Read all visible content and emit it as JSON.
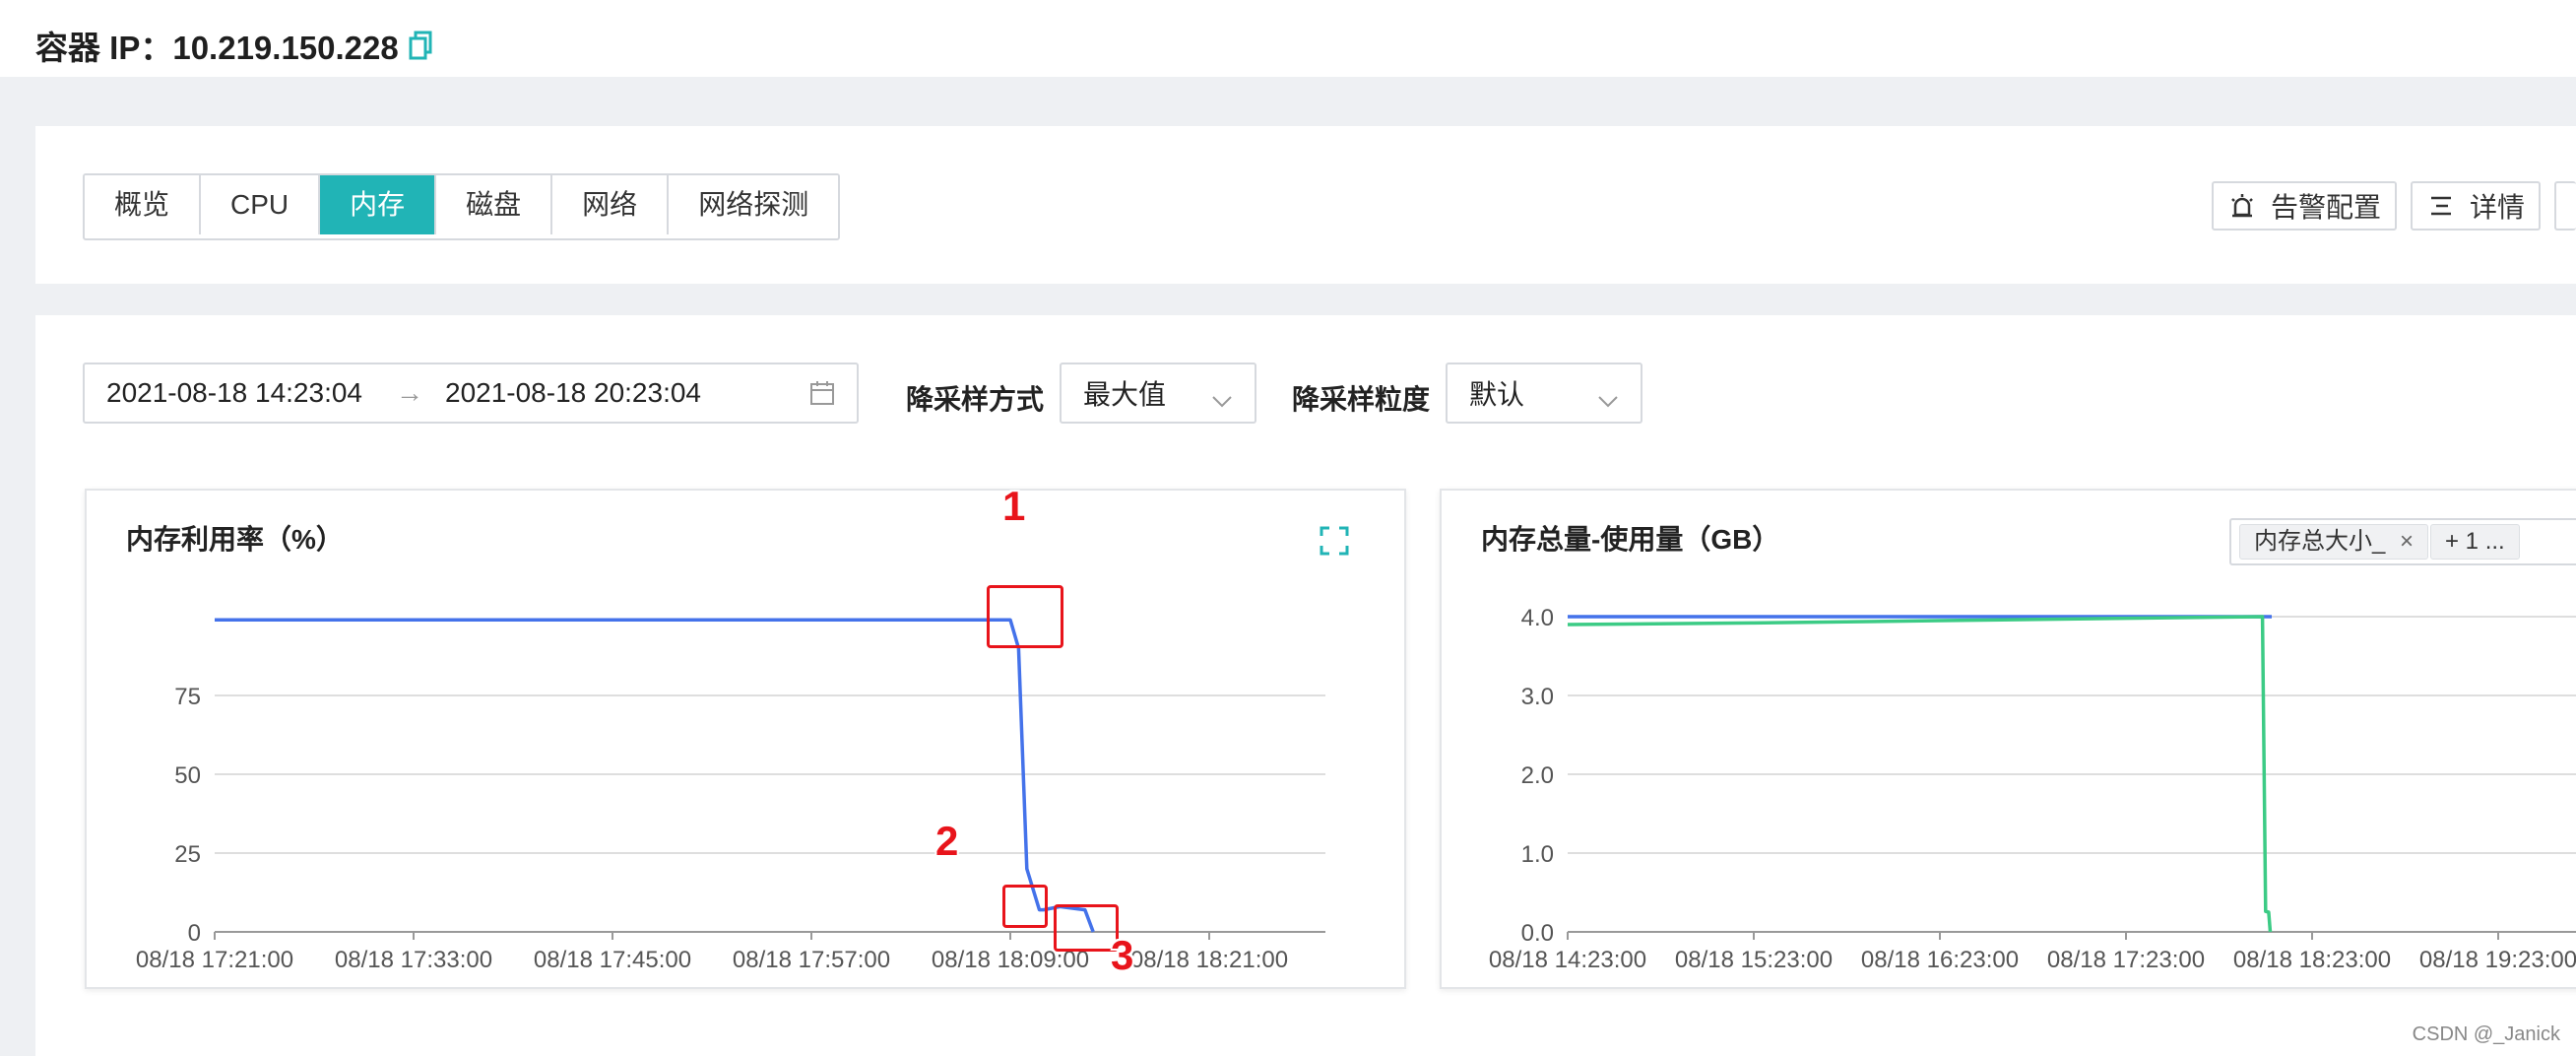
{
  "header": {
    "container_ip_label": "容器 IP：10.219.150.228"
  },
  "tabs": [
    {
      "label": "概览"
    },
    {
      "label": "CPU"
    },
    {
      "label": "内存",
      "active": true
    },
    {
      "label": "磁盘"
    },
    {
      "label": "网络"
    },
    {
      "label": "网络探测"
    }
  ],
  "actions": {
    "alert_config": "告警配置",
    "details": "详情"
  },
  "filters": {
    "date_start": "2021-08-18 14:23:04",
    "date_arrow": "→",
    "date_end": "2021-08-18 20:23:04",
    "downsample_method_label": "降采样方式",
    "downsample_method_value": "最大值",
    "downsample_granularity_label": "降采样粒度",
    "downsample_granularity_value": "默认"
  },
  "colors": {
    "accent": "#21b4b6",
    "series_blue": "#4472ea",
    "series_green": "#3ccb85",
    "marker_red": "#e8141b"
  },
  "chart_usage": {
    "title": "内存利用率（%）",
    "type": "line",
    "x_ticks": [
      "08/18 17:21:00",
      "08/18 17:33:00",
      "08/18 17:45:00",
      "08/18 17:57:00",
      "08/18 18:09:00",
      "08/18 18:21:00"
    ],
    "y_ticks": [
      "0",
      "25",
      "50",
      "75"
    ],
    "ylim": [
      0,
      100
    ],
    "grid": true
  },
  "chart_total": {
    "title": "内存总量-使用量（GB）",
    "type": "line",
    "chip_1": "内存总大小_",
    "chip_2": "+ 1 ...",
    "x_ticks": [
      "08/18 14:23:00",
      "08/18 15:23:00",
      "08/18 16:23:00",
      "08/18 17:23:00",
      "08/18 18:23:00",
      "08/18 19:23:00"
    ],
    "y_ticks": [
      "0.0",
      "1.0",
      "2.0",
      "3.0",
      "4.0"
    ],
    "ylim": [
      0,
      4.0
    ],
    "grid": true
  },
  "chart_data": [
    {
      "type": "line",
      "title": "内存利用率（%）",
      "xlabel": "",
      "ylabel": "",
      "ylim": [
        0,
        100
      ],
      "series": [
        {
          "x": [
            "08/18 17:21:00",
            "08/18 17:33:00",
            "08/18 17:45:00",
            "08/18 17:57:00",
            "08/18 18:09:00",
            "08/18 18:09:30",
            "08/18 18:10:00",
            "08/18 18:10:45",
            "08/18 18:11:00",
            "08/18 18:12:00",
            "08/18 18:13:30",
            "08/18 18:14:00"
          ],
          "y": [
            99,
            99,
            99,
            99,
            99,
            90,
            20,
            7,
            7,
            8,
            7,
            0
          ]
        }
      ]
    },
    {
      "type": "line",
      "title": "内存总量-使用量（GB）",
      "xlabel": "",
      "ylabel": "",
      "ylim": [
        0,
        4.0
      ],
      "series": [
        {
          "name": "内存总大小_",
          "x": [
            "08/18 14:23:00",
            "08/18 15:23:00",
            "08/18 16:23:00",
            "08/18 17:23:00",
            "08/18 18:07:00",
            "08/18 18:10:00"
          ],
          "y": [
            4.0,
            4.0,
            4.0,
            4.0,
            4.0,
            4.0
          ]
        },
        {
          "x": [
            "08/18 14:23:00",
            "08/18 15:23:00",
            "08/18 16:23:00",
            "08/18 17:23:00",
            "08/18 18:07:00",
            "08/18 18:08:00",
            "08/18 18:09:00",
            "08/18 18:09:30"
          ],
          "y": [
            3.9,
            3.92,
            3.95,
            3.98,
            4.0,
            0.26,
            0.25,
            0.0
          ]
        }
      ]
    }
  ],
  "annotations": [
    "1",
    "2",
    "3"
  ],
  "watermark": "CSDN @_Janick"
}
